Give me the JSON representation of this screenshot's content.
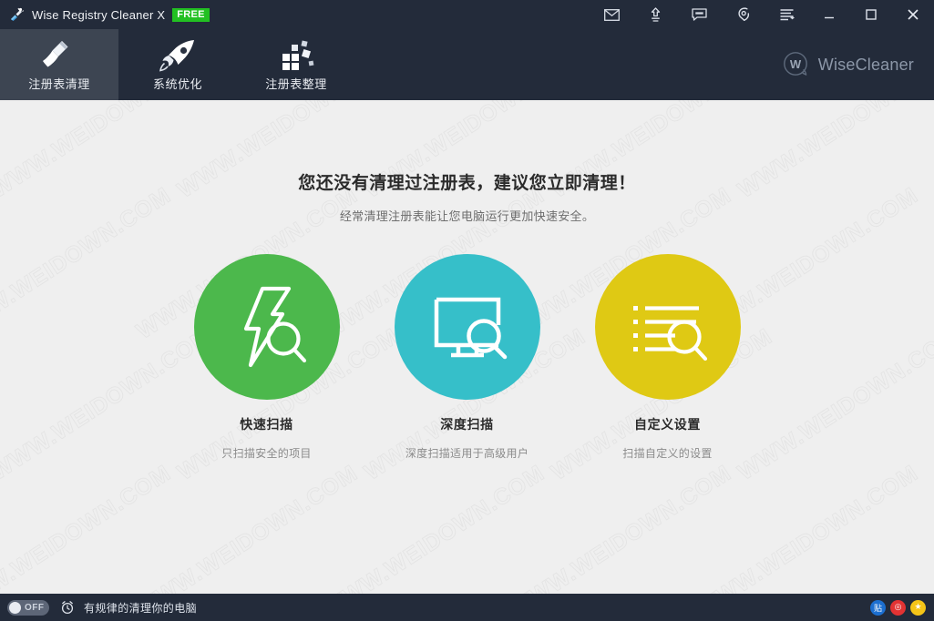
{
  "window": {
    "title": "Wise Registry Cleaner X",
    "badge": "FREE",
    "app_icon": "broom-app-icon"
  },
  "titlebar_icons": [
    {
      "name": "mail-icon",
      "label": "Mail"
    },
    {
      "name": "upgrade-icon",
      "label": "Upgrade"
    },
    {
      "name": "feedback-icon",
      "label": "Feedback"
    },
    {
      "name": "support-icon",
      "label": "Support"
    },
    {
      "name": "menu-icon",
      "label": "Menu"
    }
  ],
  "window_controls": {
    "minimize": "minimize-icon",
    "maximize": "maximize-icon",
    "close": "close-icon"
  },
  "nav": {
    "tabs": [
      {
        "label": "注册表清理",
        "icon": "broom-icon",
        "active": true
      },
      {
        "label": "系统优化",
        "icon": "rocket-icon",
        "active": false
      },
      {
        "label": "注册表整理",
        "icon": "defrag-icon",
        "active": false
      }
    ]
  },
  "brand": {
    "mark": "wisecleaner-logo",
    "name": "WiseCleaner"
  },
  "main": {
    "headline": "您还没有清理过注册表，建议您立即清理！",
    "subline": "经常清理注册表能让您电脑运行更加快速安全。",
    "actions": [
      {
        "title": "快速扫描",
        "desc": "只扫描安全的项目",
        "color": "#4cb84c",
        "icon": "lightning-search-icon"
      },
      {
        "title": "深度扫描",
        "desc": "深度扫描适用于高级用户",
        "color": "#36bfc9",
        "icon": "monitor-search-icon"
      },
      {
        "title": "自定义设置",
        "desc": "扫描自定义的设置",
        "color": "#dfc914",
        "icon": "list-search-icon"
      }
    ]
  },
  "statusbar": {
    "toggle_state": "OFF",
    "alarm_icon": "alarm-clock-icon",
    "text": "有规律的清理你的电脑",
    "social": [
      {
        "name": "tieba-icon",
        "glyph": "贴",
        "color": "#1c6fd0"
      },
      {
        "name": "weibo-icon",
        "glyph": "◎",
        "color": "#e23333"
      },
      {
        "name": "favorite-icon",
        "glyph": "★",
        "color": "#f5c518"
      }
    ]
  },
  "watermark": {
    "text": "WWW.WEIDOWN.COM"
  },
  "colors": {
    "header_bg": "#232b3a",
    "active_tab_bg": "#3d4552",
    "body_bg": "#efefef",
    "badge_green": "#22c022"
  }
}
